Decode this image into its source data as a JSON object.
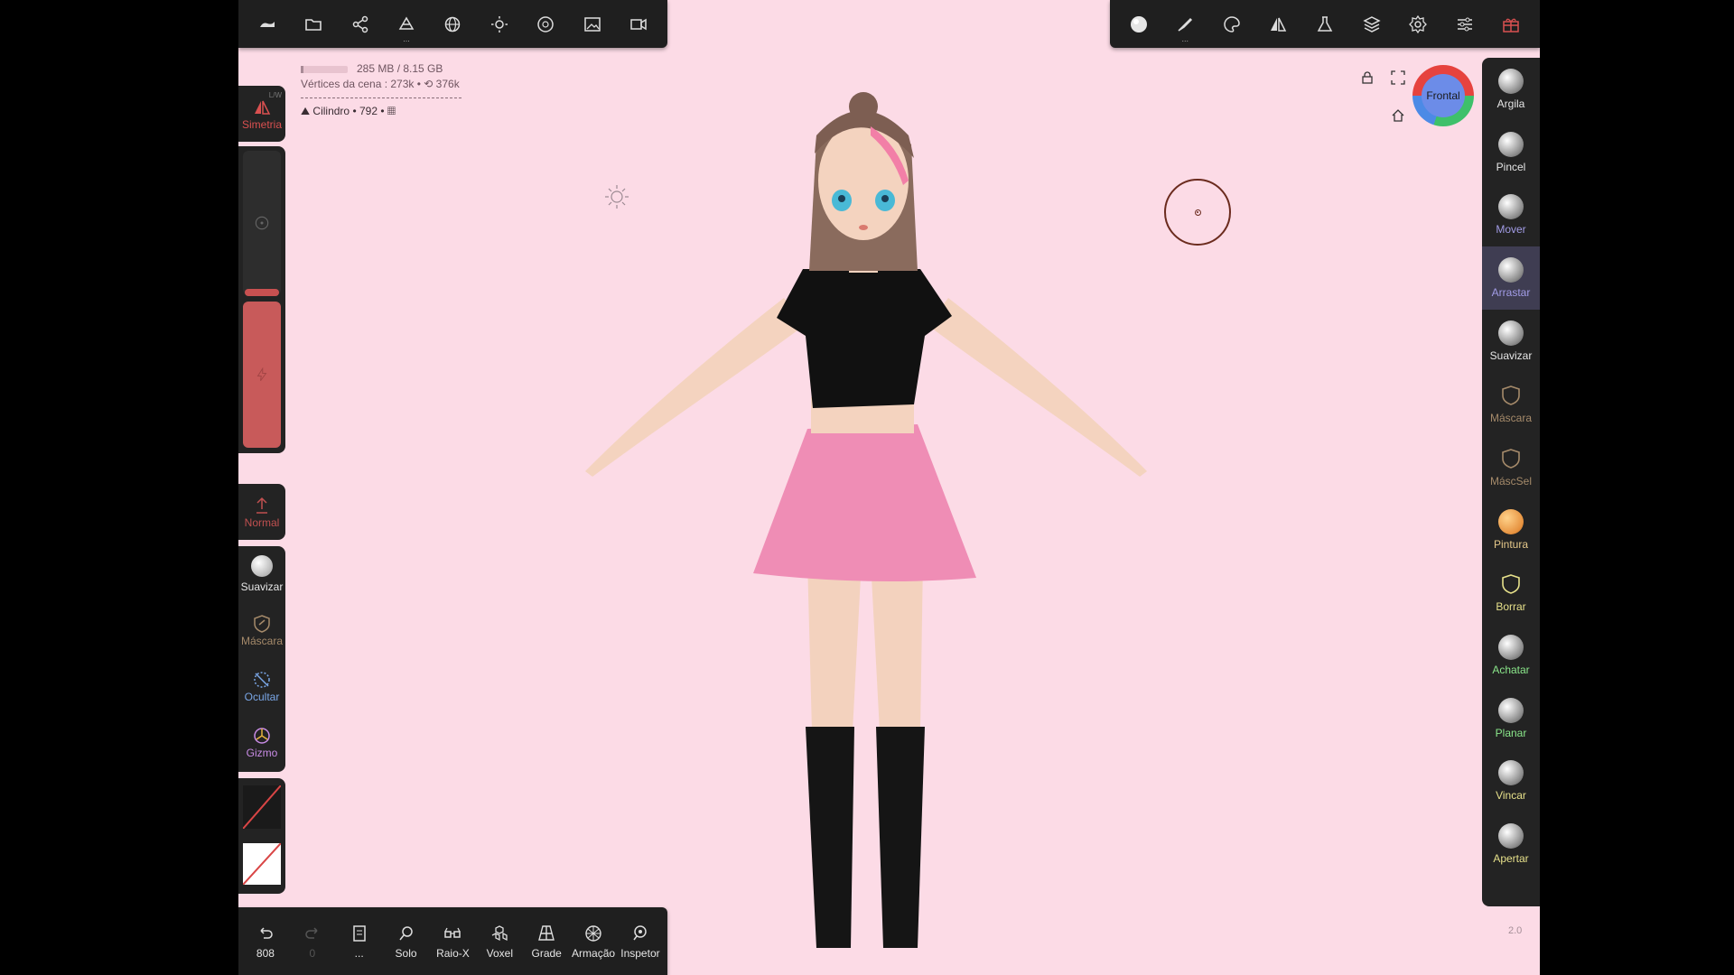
{
  "top_toolbar_left": [
    {
      "name": "scene-icon"
    },
    {
      "name": "folder-icon"
    },
    {
      "name": "share-icon"
    },
    {
      "name": "mesh-icon",
      "dots": "..."
    },
    {
      "name": "sphere-grid-icon"
    },
    {
      "name": "sun-icon"
    },
    {
      "name": "aperture-icon"
    },
    {
      "name": "image-icon"
    },
    {
      "name": "video-camera-icon"
    }
  ],
  "top_toolbar_right": [
    {
      "name": "material-sphere-icon"
    },
    {
      "name": "brush-icon",
      "dots": "..."
    },
    {
      "name": "palette-icon"
    },
    {
      "name": "symmetry-icon"
    },
    {
      "name": "flask-icon"
    },
    {
      "name": "layers-icon"
    },
    {
      "name": "settings-icon"
    },
    {
      "name": "sliders-icon"
    },
    {
      "name": "gift-icon"
    }
  ],
  "hud": {
    "memory": "285 MB / 8.15 GB",
    "vertices": "Vértices da cena : 273k • ⟲ 376k",
    "object": "Cilindro • 792 •"
  },
  "left_panel": {
    "symmetry_label": "Simetria",
    "symmetry_badge": "L/W",
    "normal_label": "Normal",
    "tools": [
      {
        "label": "Suavizar",
        "color": "#e6e6e6"
      },
      {
        "label": "Máscara",
        "color": "#a58a6a"
      },
      {
        "label": "Ocultar",
        "color": "#7aa6e6"
      },
      {
        "label": "Gizmo",
        "color": "#c98ce6"
      }
    ]
  },
  "right_panel": [
    {
      "label": "Argila",
      "color": "#e6e6e6"
    },
    {
      "label": "Pincel",
      "color": "#e6e6e6"
    },
    {
      "label": "Mover",
      "color": "#a29ce6"
    },
    {
      "label": "Arrastar",
      "color": "#a29ce6",
      "active": true
    },
    {
      "label": "Suavizar",
      "color": "#e6e6e6"
    },
    {
      "label": "Máscara",
      "color": "#a58a6a"
    },
    {
      "label": "MáscSel",
      "color": "#a58a6a"
    },
    {
      "label": "Pintura",
      "color": "#e6c98a"
    },
    {
      "label": "Borrar",
      "color": "#e6e08a"
    },
    {
      "label": "Achatar",
      "color": "#8ae68a"
    },
    {
      "label": "Planar",
      "color": "#8ae68a"
    },
    {
      "label": "Vincar",
      "color": "#e6e08a"
    },
    {
      "label": "Apertar",
      "color": "#e6e08a"
    }
  ],
  "bottom_bar": [
    {
      "name": "undo-button",
      "label": "808"
    },
    {
      "name": "redo-button",
      "label": "0"
    },
    {
      "name": "doc-button",
      "label": "..."
    },
    {
      "name": "solo-button",
      "label": "Solo"
    },
    {
      "name": "xray-button",
      "label": "Raio-X"
    },
    {
      "name": "voxel-button",
      "label": "Voxel"
    },
    {
      "name": "grid-button",
      "label": "Grade"
    },
    {
      "name": "wireframe-button",
      "label": "Armação"
    },
    {
      "name": "inspector-button",
      "label": "Inspetor"
    }
  ],
  "view_cube_label": "Frontal",
  "version": "2.0"
}
